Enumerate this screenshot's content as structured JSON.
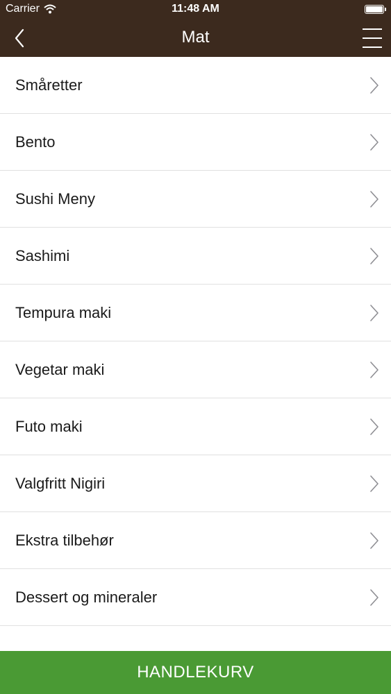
{
  "status_bar": {
    "carrier": "Carrier",
    "time": "11:48 AM"
  },
  "nav": {
    "title": "Mat",
    "back_icon": "chevron-left-icon",
    "menu_icon": "hamburger-menu-icon"
  },
  "menu_items": [
    {
      "label": "Småretter"
    },
    {
      "label": "Bento"
    },
    {
      "label": "Sushi Meny"
    },
    {
      "label": "Sashimi"
    },
    {
      "label": "Tempura maki"
    },
    {
      "label": "Vegetar maki"
    },
    {
      "label": "Futo maki"
    },
    {
      "label": "Valgfritt Nigiri"
    },
    {
      "label": "Ekstra tilbehør"
    },
    {
      "label": "Dessert og mineraler"
    }
  ],
  "cart": {
    "label": "HANDLEKURV"
  },
  "colors": {
    "header_bg": "#3c2a1e",
    "cart_bg": "#4a9a34",
    "divider": "#e0e0e0",
    "chevron": "#8e8e93"
  }
}
